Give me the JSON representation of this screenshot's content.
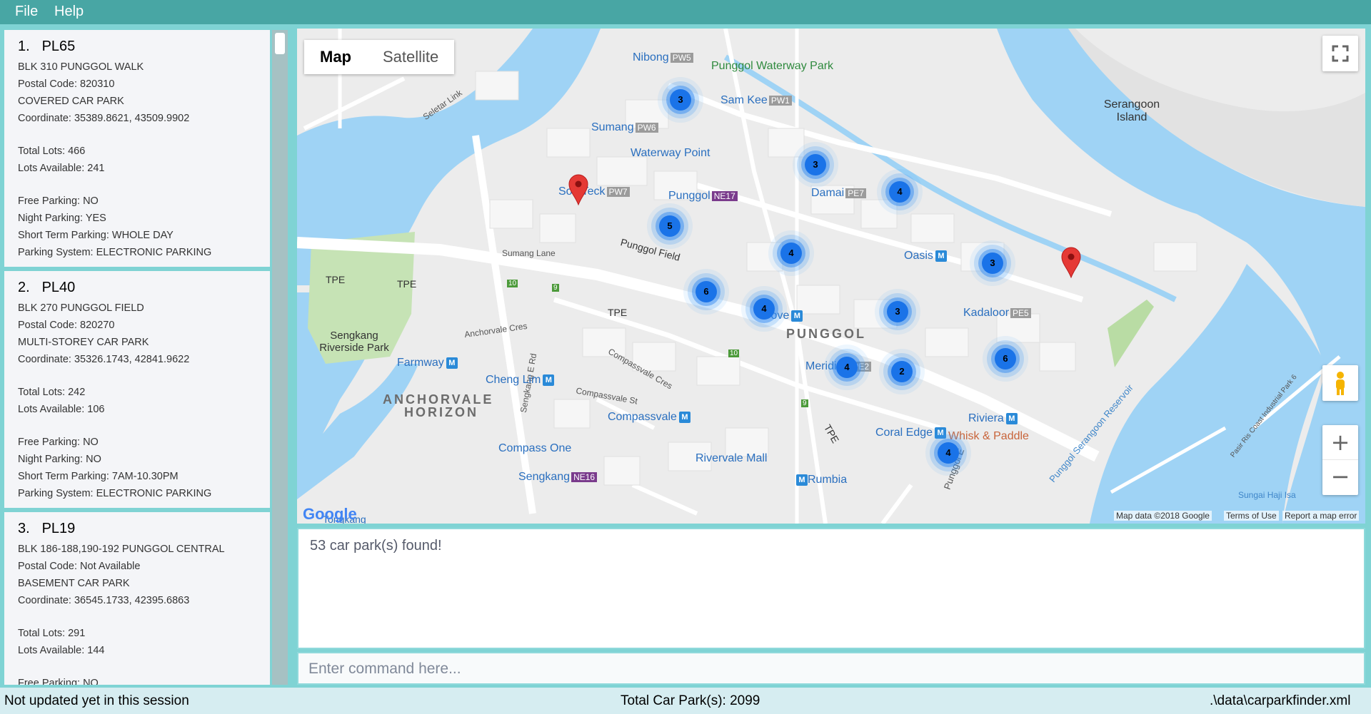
{
  "menu": {
    "file": "File",
    "help": "Help"
  },
  "carparks": [
    {
      "index": "1.",
      "id": "PL65",
      "address": "BLK 310 PUNGGOL WALK",
      "postal": "Postal Code: 820310",
      "type": "COVERED CAR PARK",
      "coordinate": "Coordinate: 35389.8621, 43509.9902",
      "total_lots": "Total Lots: 466",
      "lots_available": "Lots Available: 241",
      "free_parking": "Free Parking: NO",
      "night_parking": "Night Parking: YES",
      "short_term": "Short Term Parking: WHOLE DAY",
      "system": "Parking System: ELECTRONIC PARKING"
    },
    {
      "index": "2.",
      "id": "PL40",
      "address": "BLK 270 PUNGGOL FIELD",
      "postal": "Postal Code: 820270",
      "type": "MULTI-STOREY CAR PARK",
      "coordinate": "Coordinate: 35326.1743, 42841.9622",
      "total_lots": "Total Lots: 242",
      "lots_available": "Lots Available: 106",
      "free_parking": "Free Parking: NO",
      "night_parking": "Night Parking: NO",
      "short_term": "Short Term Parking: 7AM-10.30PM",
      "system": "Parking System: ELECTRONIC PARKING"
    },
    {
      "index": "3.",
      "id": "PL19",
      "address": "BLK 186-188,190-192 PUNGGOL CENTRAL",
      "postal": "Postal Code: Not Available",
      "type": "BASEMENT CAR PARK",
      "coordinate": "Coordinate: 36545.1733, 42395.6863",
      "total_lots": "Total Lots: 291",
      "lots_available": "Lots Available: 144",
      "free_parking": "Free Parking: NO",
      "night_parking": "",
      "short_term": "",
      "system": ""
    }
  ],
  "map": {
    "type_map": "Map",
    "type_satellite": "Satellite",
    "zoom_in": "+",
    "zoom_out": "−",
    "labels": {
      "nibong": "Nibong",
      "nibong_code": "PW5",
      "punggol_waterway_park": "Punggol Waterway Park",
      "sam_kee": "Sam Kee",
      "sam_kee_code": "PW1",
      "sumang": "Sumang",
      "sumang_code": "PW6",
      "waterway_point": "Waterway Point",
      "serangoon_island": "Serangoon Island",
      "seletar_link": "Seletar Link",
      "soo_teck": "Soo Teck",
      "soo_teck_code": "PW7",
      "punggol": "Punggol",
      "punggol_code": "NE17",
      "damai": "Damai",
      "damai_code": "PE7",
      "oasis": "Oasis",
      "punggol_field": "Punggol Field",
      "sumang_lane": "Sumang Lane",
      "tpe1": "TPE",
      "tpe2": "TPE",
      "tpe3": "TPE",
      "tpe4": "TPE",
      "kadaloor": "Kadaloor",
      "kadaloor_code": "PE5",
      "cove": "Cove",
      "punggol_area": "PUNGGOL",
      "sengkang_riverside_park": "Sengkang Riverside Park",
      "farmway": "Farmway",
      "anchorvale_cres": "Anchorvale Cres",
      "sengkang_e_rd": "Sengkang E Rd",
      "compassvale_cres": "Compassvale Cres",
      "cheng_lim": "Cheng Lim",
      "meridian": "Meridian",
      "meridian_code": "PE2",
      "anchorvale_horizon_1": "ANCHORVALE",
      "anchorvale_horizon_2": "HORIZON",
      "compassvale_st": "Compassvale St",
      "compassvale": "Compassvale",
      "riviera": "Riviera",
      "coral_edge": "Coral Edge",
      "whisk_paddle": "Whisk & Paddle",
      "compass_one": "Compass One",
      "rivervale_mall": "Rivervale Mall",
      "sengkang": "Sengkang",
      "sengkang_code": "NE16",
      "rumbia": "Rumbia",
      "punggol_e": "Punggol E",
      "punggol_serangoon_reservoir": "Punggol Serangoon Reservoir",
      "pasir_ris_coast": "Pasir Ris Coast Industrial Park 6",
      "sungai_haji_isa": "Sungai Haji Isa",
      "tongkang": "Tongkang",
      "route_10a": "10",
      "route_9a": "9",
      "route_10b": "10",
      "route_9b": "9"
    },
    "clusters": [
      "3",
      "3",
      "4",
      "5",
      "4",
      "3",
      "6",
      "4",
      "3",
      "6",
      "4",
      "2",
      "4"
    ],
    "footer": {
      "google": "Google",
      "map_data": "Map data ©2018 Google",
      "terms": "Terms of Use",
      "report": "Report a map error"
    }
  },
  "result": {
    "text": "53 car park(s) found!"
  },
  "command": {
    "placeholder": "Enter command here..."
  },
  "status": {
    "left": "Not updated yet in this session",
    "center": "Total Car Park(s): 2099",
    "right": ".\\data\\carparkfinder.xml"
  }
}
